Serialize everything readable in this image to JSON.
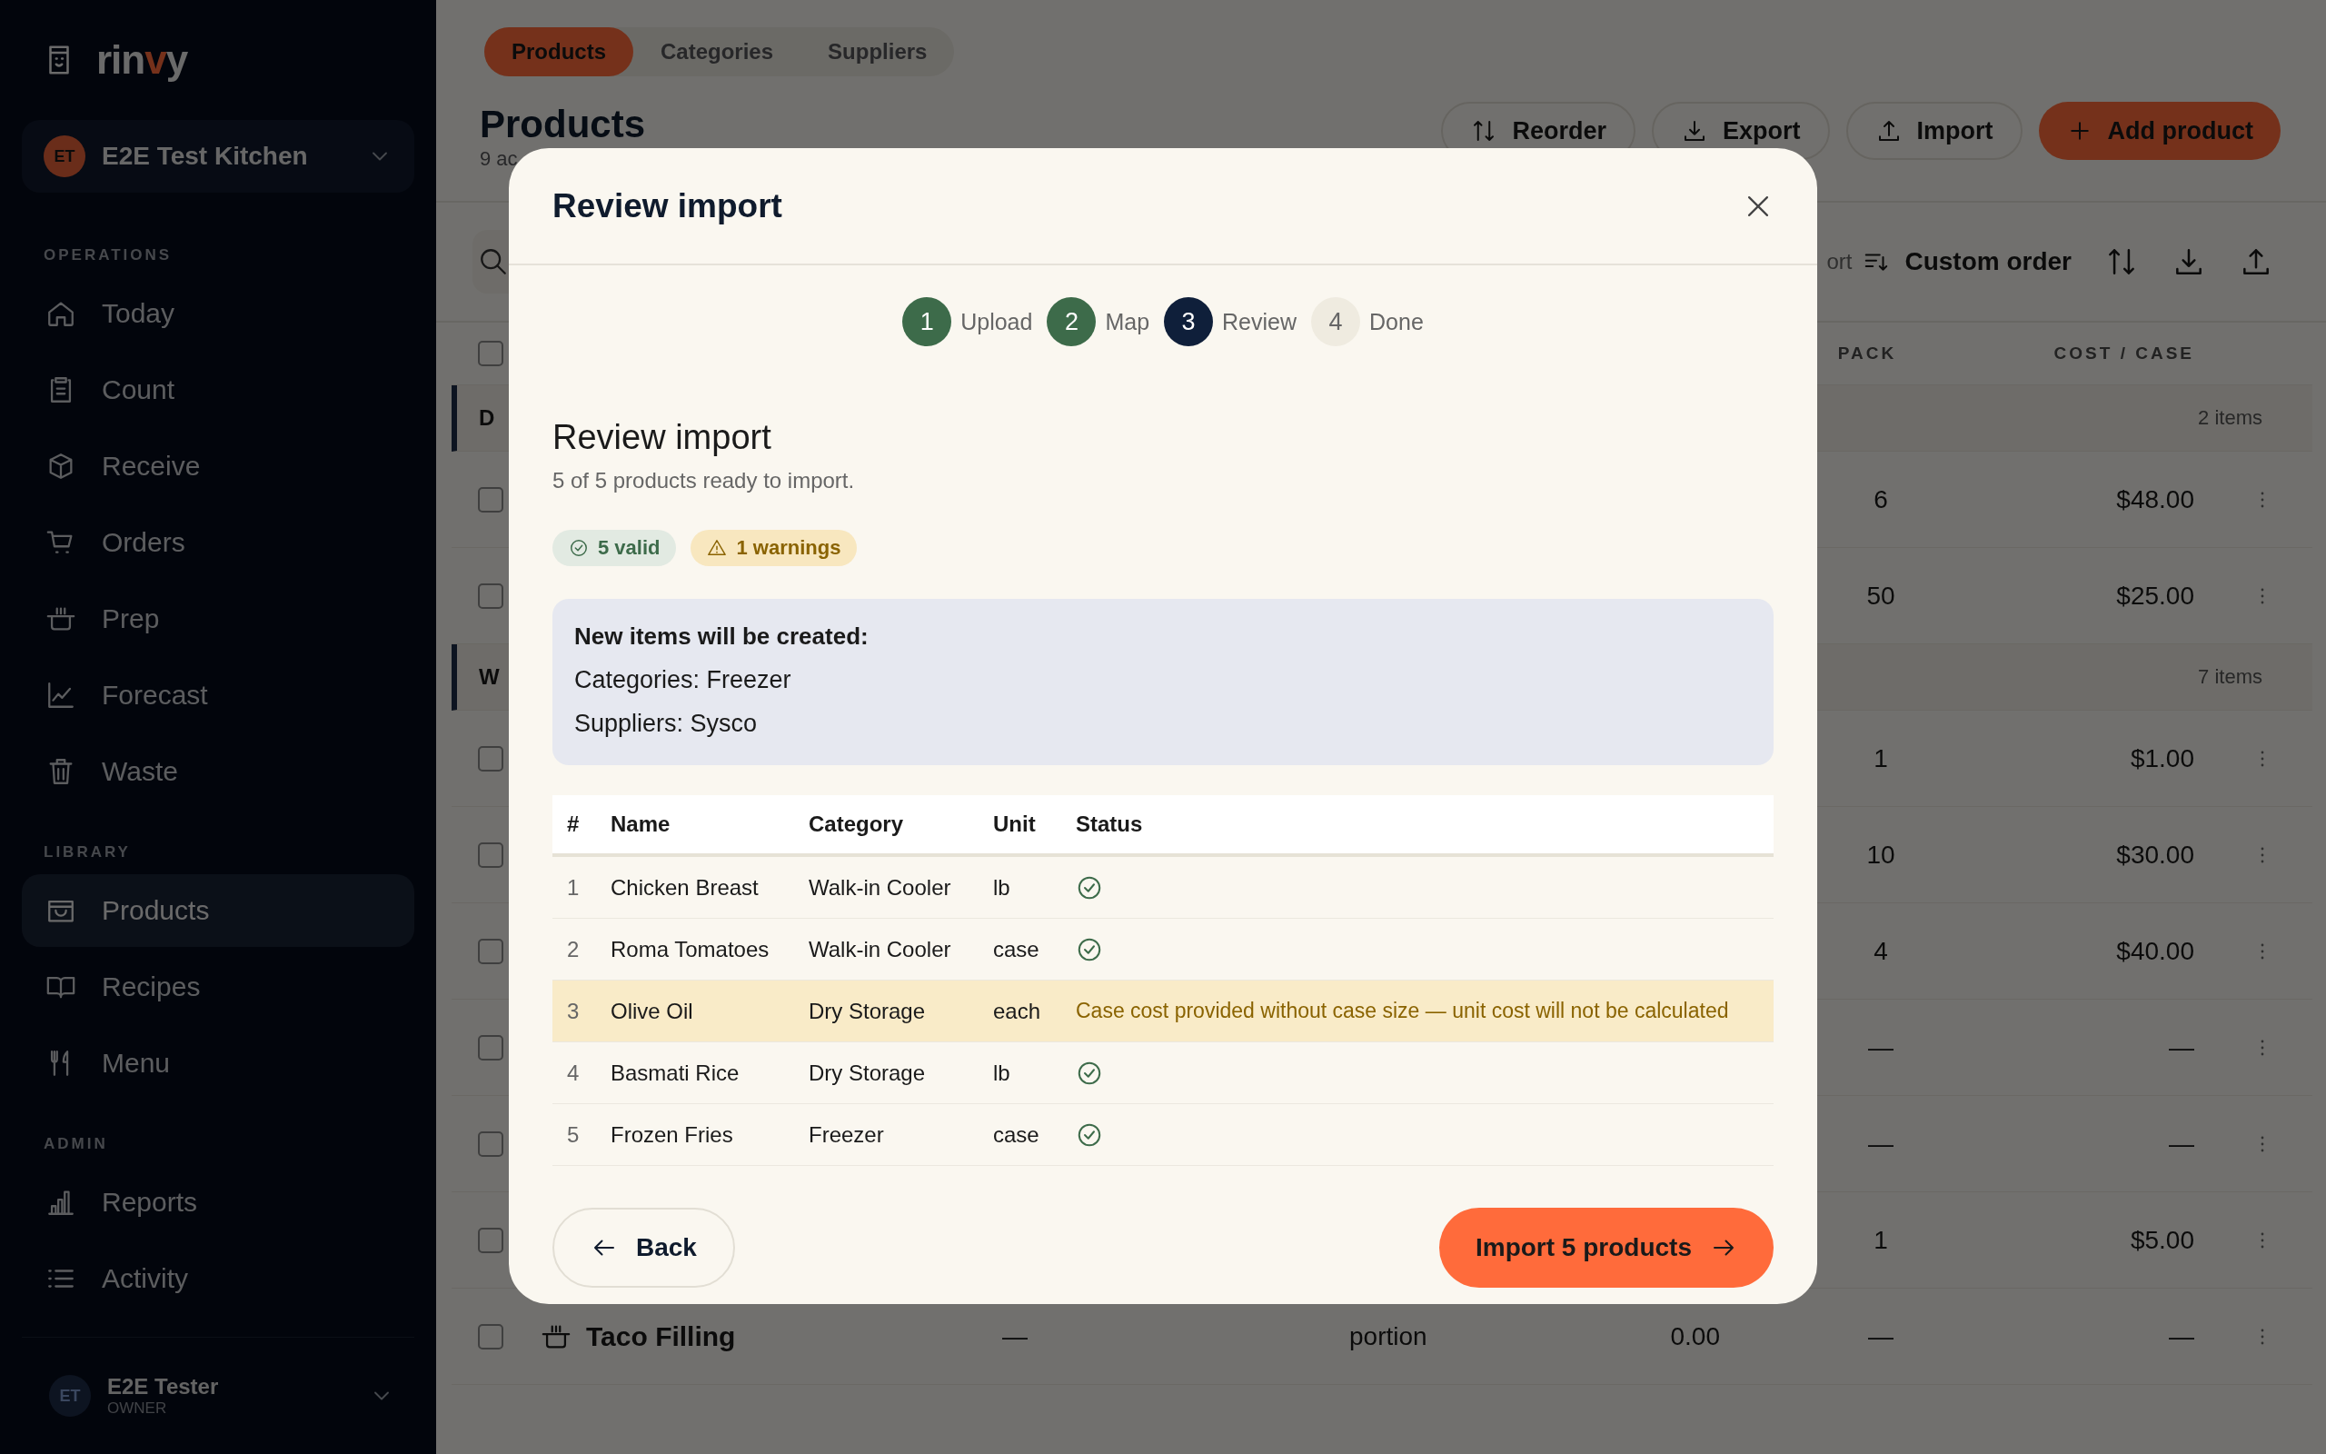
{
  "sidebar": {
    "logo": {
      "before": "rin",
      "accent": "v",
      "after": "y"
    },
    "workspace": {
      "initials": "ET",
      "name": "E2E Test Kitchen"
    },
    "sections": [
      {
        "title": "OPERATIONS",
        "items": [
          {
            "label": "Today",
            "selected": false
          },
          {
            "label": "Count",
            "selected": false
          },
          {
            "label": "Receive",
            "selected": false
          },
          {
            "label": "Orders",
            "selected": false
          },
          {
            "label": "Prep",
            "selected": false
          },
          {
            "label": "Forecast",
            "selected": false
          },
          {
            "label": "Waste",
            "selected": false
          }
        ]
      },
      {
        "title": "LIBRARY",
        "items": [
          {
            "label": "Products",
            "selected": true
          },
          {
            "label": "Recipes",
            "selected": false
          },
          {
            "label": "Menu",
            "selected": false
          }
        ]
      },
      {
        "title": "ADMIN",
        "items": [
          {
            "label": "Reports",
            "selected": false
          },
          {
            "label": "Activity",
            "selected": false
          }
        ]
      }
    ],
    "user": {
      "initials": "ET",
      "name": "E2E Tester",
      "role": "OWNER"
    }
  },
  "main": {
    "tabs": [
      {
        "label": "Products",
        "selected": true
      },
      {
        "label": "Categories",
        "selected": false
      },
      {
        "label": "Suppliers",
        "selected": false
      }
    ],
    "title": "Products",
    "subtitle": "9 ac",
    "actions": [
      {
        "label": "Reorder",
        "kind": "outline"
      },
      {
        "label": "Export",
        "kind": "outline"
      },
      {
        "label": "Import",
        "kind": "outline"
      },
      {
        "label": "Add product",
        "kind": "primary"
      }
    ],
    "toolbar": {
      "sort_label": "ort",
      "sort_value": "Custom order"
    },
    "table": {
      "all_checked": false,
      "columns": [
        "PACK",
        "COST / CASE"
      ],
      "groups": [
        {
          "label": "D",
          "count": "2 items",
          "rows": [
            {
              "checked": false,
              "pack": "6",
              "cost": "$48.00"
            },
            {
              "checked": false,
              "pack": "50",
              "cost": "$25.00"
            }
          ]
        },
        {
          "label": "W",
          "count": "7 items",
          "rows": [
            {
              "checked": false,
              "pack": "1",
              "cost": "$1.00"
            },
            {
              "checked": false,
              "pack": "10",
              "cost": "$30.00"
            },
            {
              "checked": false,
              "pack": "4",
              "cost": "$40.00"
            },
            {
              "checked": false,
              "pack": "—",
              "cost": "—"
            },
            {
              "checked": false,
              "pack": "—",
              "cost": "—"
            },
            {
              "checked": false,
              "pack": "1",
              "cost": "$5.00"
            },
            {
              "checked": false,
              "name": "Taco Filling",
              "column_3": "—",
              "column_4": "portion",
              "column_5": "0.00",
              "pack": "—",
              "cost": "—"
            }
          ]
        }
      ]
    }
  },
  "modal": {
    "title": "Review import",
    "steps": [
      {
        "number": "1",
        "label": "Upload",
        "completed": true,
        "selected": false
      },
      {
        "number": "2",
        "label": "Map",
        "completed": true,
        "selected": false
      },
      {
        "number": "3",
        "label": "Review",
        "completed": false,
        "selected": true
      },
      {
        "number": "4",
        "label": "Done",
        "completed": false,
        "selected": false
      }
    ],
    "heading": "Review import",
    "summary": "5 of 5 products ready to import.",
    "badges": [
      {
        "label": "5 valid",
        "kind": "valid"
      },
      {
        "label": "1 warnings",
        "kind": "warning"
      }
    ],
    "notice": {
      "title": "New items will be created:",
      "lines": [
        "Categories: Freezer",
        "Suppliers: Sysco"
      ]
    },
    "table": {
      "columns": [
        "#",
        "Name",
        "Category",
        "Unit",
        "Status"
      ],
      "rows": [
        {
          "number": "1",
          "name": "Chicken Breast",
          "category": "Walk-in Cooler",
          "unit": "lb",
          "kind": "valid"
        },
        {
          "number": "2",
          "name": "Roma Tomatoes",
          "category": "Walk-in Cooler",
          "unit": "case",
          "kind": "valid"
        },
        {
          "number": "3",
          "name": "Olive Oil",
          "category": "Dry Storage",
          "unit": "each",
          "kind": "warning",
          "message": "Case cost provided without case size — unit cost will not be calculated"
        },
        {
          "number": "4",
          "name": "Basmati Rice",
          "category": "Dry Storage",
          "unit": "lb",
          "kind": "valid"
        },
        {
          "number": "5",
          "name": "Frozen Fries",
          "category": "Freezer",
          "unit": "case",
          "kind": "valid"
        }
      ]
    },
    "back": "Back",
    "confirm": "Import 5 products"
  }
}
